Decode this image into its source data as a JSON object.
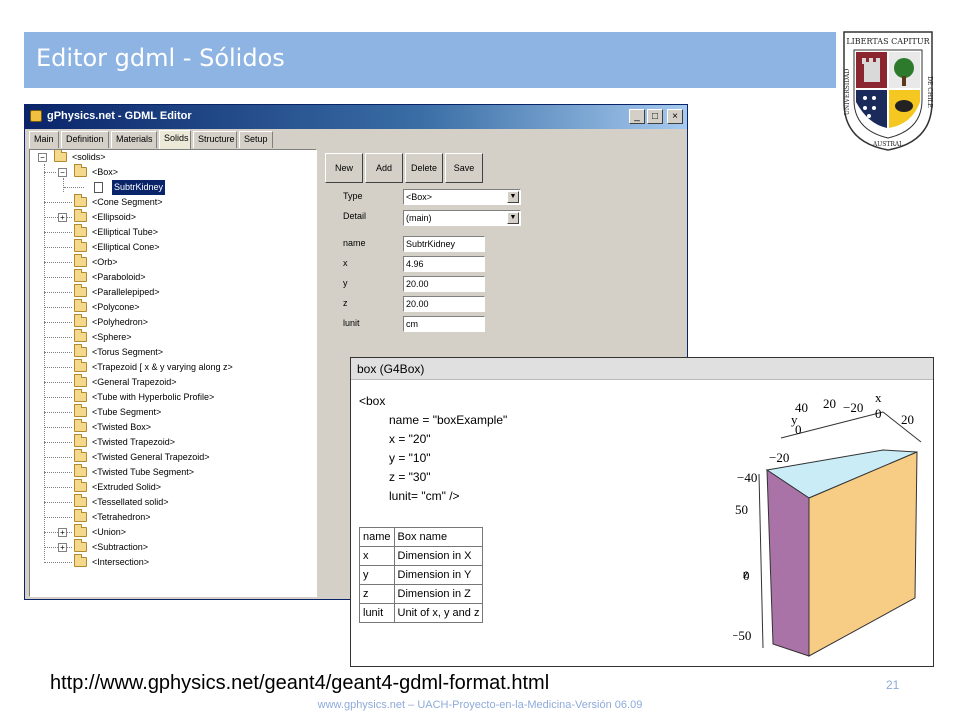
{
  "slide": {
    "title": "Editor gdml - Sólidos",
    "url": "http://www.gphysics.net/geant4/geant4-gdml-format.html",
    "page_number": "21",
    "footer": "www.gphysics.net – UACH-Proyecto-en-la-Medicina-Versión 06.09"
  },
  "logo": {
    "motto": "LIBERTAS CAPITUR",
    "ring_text": "UNIVERSIDAD AUSTRAL DE CHILE"
  },
  "window": {
    "title": "gPhysics.net - GDML Editor",
    "tabs": [
      "Main",
      "Definition",
      "Materials",
      "Solids",
      "Structure",
      "Setup"
    ],
    "active_tab": "Solids",
    "tree": {
      "root": "<solids>",
      "items": [
        "<Box>",
        "SubtrKidney",
        "<Cone Segment>",
        "<Ellipsoid>",
        "<Elliptical Tube>",
        "<Elliptical Cone>",
        "<Orb>",
        "<Paraboloid>",
        "<Parallelepiped>",
        "<Polycone>",
        "<Polyhedron>",
        "<Sphere>",
        "<Torus Segment>",
        "<Trapezoid [ x & y varying along z>",
        "<General Trapezoid>",
        "<Tube with Hyperbolic Profile>",
        "<Tube Segment>",
        "<Twisted Box>",
        "<Twisted Trapezoid>",
        "<Twisted General Trapezoid>",
        "<Twisted Tube Segment>",
        "<Extruded Solid>",
        "<Tessellated solid>",
        "<Tetrahedron>",
        "<Union>",
        "<Subtraction>",
        "<Intersection>"
      ]
    },
    "buttons": {
      "new": "New",
      "add": "Add",
      "delete": "Delete",
      "save": "Save"
    },
    "props": {
      "type_label": "Type",
      "type_value": "<Box>",
      "detail_label": "Detail",
      "detail_value": "(main)",
      "name_label": "name",
      "name_value": "SubtrKidney",
      "x_label": "x",
      "x_value": "4.96",
      "y_label": "y",
      "y_value": "20.00",
      "z_label": "z",
      "z_value": "20.00",
      "lunit_label": "lunit",
      "lunit_value": "cm"
    }
  },
  "box_panel": {
    "header": "box (G4Box)",
    "code": [
      "<box",
      "name = \"boxExample\"",
      "x = \"20\"",
      "y = \"10\"",
      "z = \"30\"",
      "lunit= \"cm\" />"
    ],
    "table": [
      [
        "name",
        "Box name"
      ],
      [
        "x",
        "Dimension in X"
      ],
      [
        "y",
        "Dimension in Y"
      ],
      [
        "z",
        "Dimension in Z"
      ],
      [
        "lunit",
        "Unit of x, y and z"
      ]
    ],
    "plot": {
      "x_label": "x",
      "y_label": "y",
      "z_label": "z",
      "top_ticks": [
        "40",
        "20",
        "0",
        "−20",
        "−40",
        "−20",
        "0",
        "20"
      ],
      "z_ticks": [
        "50",
        "0",
        "−50"
      ],
      "colors": {
        "top": "#c9ecf7",
        "front": "#a973a8",
        "right": "#f7cd85"
      }
    }
  }
}
